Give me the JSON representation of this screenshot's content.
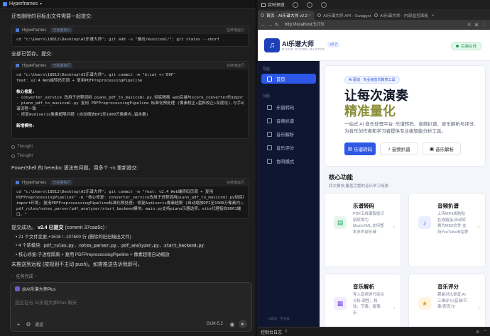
{
  "left": {
    "window_title": "Hyperframes",
    "intro_text": "还有删除的目标出文件需要一起提交:",
    "block1": {
      "label": "Hyperframes",
      "chip": "已批量执行",
      "action": "在终端运行",
      "lines": [
        "cd \"c:\\Users\\18812\\Desktop\\AI乐谱大师\"; git add -u \"输出/musicxml/\"; git status --short"
      ]
    },
    "staged_text": "全部已暂存。提交:",
    "block2": {
      "label": "Hyperframes",
      "chip": "已批量执行",
      "action": "在终端运行",
      "lines": [
        "cd \"c:\\Users\\18812\\Desktop\\AI乐谱大师\"; git commit -m \"$(cat <<'EOF'",
        "feat: v2.4 Web端转码页调 + 复用PDFPreprocessingPipeline",
        "",
        "核心修复:",
        "- converter_service 改用于进程调用 piano_pdf_to_musicxml.py,彻底隔离 web后端与score_converter的import环境",
        "- piano_pdf_to_musicxml.py 复用 PDFPreprocessingPipeline 标准化预处理 (像素校正+歪斜校正+灰度化),与手动转",
        "  谱流程一致",
        "- 修复Audiveris像素超限问题 (自动缩放DPI至1900万像素内,留余量)",
        "",
        "新增模块:"
      ]
    },
    "thought1": "Thought",
    "thought2": "Thought",
    "powershell_text": "PowerShell 的 heredoc 语法有问题。用多个 -m 重新提交:",
    "block3": {
      "label": "Hyperframes",
      "chip": "已批量执行",
      "action": "在终端运行",
      "lines": [
        "cd \"c:\\Users\\18812\\Desktop\\AI乐谱大师\"; git commit -m \"feat: v2.4 Web端转码页调 + 复用",
        "PDFPreprocessingPipeline\" -m \"核心修复: converter_service改用于进程调用piano_pdf_to_musicxml.py彻底隔离",
        "import环境; 复用PDFPreprocessingPipeline标准化预处理; 修复Audiveris像素超限 (自动缩放DPI至1900万像素内)。新增",
        "pdf_rules/notes_parser/pdf_analyzer/start_backend模块。main.py支持piano乐器选项。vite代理指向8001端",
        "口。\""
      ]
    },
    "commit_title": "提交成功。",
    "commit_ver": "v2.4 已提交",
    "commit_hash": "(commit 37caa5c) :",
    "bullets": {
      "b1": "21 个文件变更,+1616 / -107600 行 (删除的旧旧输出文件)",
      "b2_prefix": "4 个新模块:",
      "b2_codes": [
        "pdf_rules.py",
        "notes_parser.py",
        "pdf_analyzer.py",
        "start_backend.py"
      ],
      "b3": "核心修复:子进程隔离 + 复用 PDFPreprocessingPipeline + 像素超限自动缩放"
    },
    "unpushed": "未推送到远程 (按规则不主动 push)。如需推送告诉我即可。",
    "task_status": "任务完成",
    "composer": {
      "tag": "@AI乐谱大师Plus",
      "placeholder": "您正在与 AI乐谱大师Plus 聊天",
      "mode": "通道",
      "model": "GLM-5.2"
    }
  },
  "right": {
    "top_title": "实时预览",
    "tabs": [
      "首页 - AI乐谱大师 v2.2",
      "AI乐谱大师 API - Swagger UI",
      "AI乐谱大师 - 内部监控面板"
    ],
    "url": "http://localhost:5173/",
    "app": {
      "brand": "AI乐谱大师",
      "brand_sub": "PIANO SCORE MASTER",
      "version": "v2.2",
      "status": "后端在线",
      "nav_group1": "导航",
      "nav_group2": "功能",
      "nav": [
        "首页",
        "乐谱转码",
        "音频扒谱",
        "音乐解析",
        "音乐评分",
        "协同模式"
      ],
      "side_footer": "AI驱动 · 专业级",
      "hero_pill": "AI 驱动 · 专业级音乐教育工具",
      "hero_h1": "让每次演奏",
      "hero_h1b": "精准量化",
      "hero_desc": "一站式 AI 音乐处理平台: 乐谱转码、音频扒谱、音乐解析与评分,为音乐创作者和学习者提供专业级智能分析工具。",
      "btn1": "乐谱转码",
      "btn2": "音频扒谱",
      "btn3": "音乐解析",
      "section_title": "核心功能",
      "section_sub": "四大模块,覆盖完整的音乐学习场景",
      "cards": [
        {
          "title": "乐谱转码",
          "desc": "PDF五线谱智能识别转换为MusicXML,支持整本多声部乐谱"
        },
        {
          "title": "音频扒谱",
          "desc": "上传MP3或粘贴在线链接,自动转换为MIDI文件,支持YouTube/B站等"
        },
        {
          "title": "音乐解析",
          "desc": "导入音频进行综合分析:调性、和弦、节奏、旋律、乐"
        },
        {
          "title": "音乐评分",
          "desc": "跟曲对比录音,AI三维评分(音准/节奏/表现力)"
        }
      ]
    },
    "console": "控制台日志",
    "console_count": "0"
  }
}
